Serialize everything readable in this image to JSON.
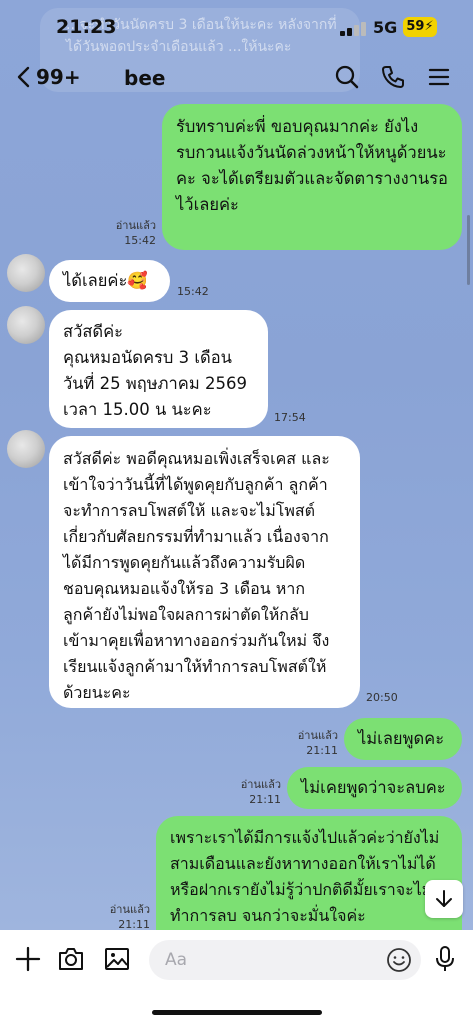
{
  "status_bar": {
    "time": "21:23",
    "network": "5G",
    "battery": "59"
  },
  "notification": {
    "text": "...จะทำวันนัดครบ 3 เดือนให้นะคะ หลังจากที่ได้วันพอดประจำเดือนแล้ว ...ให้นะคะ"
  },
  "header": {
    "back_count": "99+",
    "title": "bee"
  },
  "messages": [
    {
      "dir": "out",
      "text": "รับทราบค่ะพี่ ขอบคุณมากค่ะ ยังไง\nรบกวนแจ้งวันนัดล่วงหน้าให้หนูด้วยนะ\nคะ จะได้เตรียมตัวและจัดตารางงานรอ\nไว้เลยค่ะ",
      "read": "อ่านแล้ว",
      "time": "15:42"
    },
    {
      "dir": "in",
      "text": "ได้เลยค่ะ🥰",
      "time": "15:42"
    },
    {
      "dir": "in",
      "text": "สวัสดีค่ะ\nคุณหมอนัดครบ 3 เดือน\nวันที่ 25 พฤษภาคม 2569\nเวลา 15.00 น นะคะ",
      "time": "17:54"
    },
    {
      "dir": "in",
      "text": "สวัสดีค่ะ พอดีคุณหมอเพิ่งเสร็จเคส และ\nเข้าใจว่าวันนี้ที่ได้พูดคุยกับลูกค้า ลูกค้า\nจะทำการลบโพสต์ให้ และจะไม่โพสต์\nเกี่ยวกับศัลยกรรมที่ทำมาแล้ว เนื่องจาก\nได้มีการพูดคุยกันแล้วถึงความรับผิด\nชอบคุณหมอแจ้งให้รอ 3 เดือน หาก\nลูกค้ายังไม่พอใจผลการผ่าตัดให้กลับ\nเข้ามาคุยเพื่อหาทางออกร่วมกันใหม่ จึง\nเรียนแจ้งลูกค้ามาให้ทำการลบโพสต์ให้\nด้วยนะคะ",
      "time": "20:50"
    },
    {
      "dir": "out",
      "text": "ไม่เลยพูดคะ",
      "read": "อ่านแล้ว",
      "time": "21:11"
    },
    {
      "dir": "out",
      "text": "ไม่เคยพูดว่าจะลบคะ",
      "read": "อ่านแล้ว",
      "time": "21:11"
    },
    {
      "dir": "out",
      "text": "เพราะเราได้มีการแจ้งไปแล้วค่ะว่ายังไม่\nสามเดือนและยังหาทางออกให้เราไม่ได้\nหรือฝากเรายังไม่รู้ว่าปกติดีมั้ยเราจะไม่\nทำการลบ จนกว่าจะมั่นใจค่ะ",
      "read": "อ่านแล้ว",
      "time": "21:11"
    }
  ],
  "input": {
    "placeholder": "Aa"
  },
  "icons": {
    "header": [
      "search-icon",
      "phone-icon",
      "menu-icon"
    ],
    "input_bar": [
      "plus-icon",
      "camera-icon",
      "image-icon",
      "emoji-icon",
      "microphone-icon"
    ]
  },
  "colors": {
    "chat_bg": "#8aa4d6",
    "outgoing_bubble": "#7ce073",
    "incoming_bubble": "#ffffff",
    "battery": "#f2d200"
  }
}
